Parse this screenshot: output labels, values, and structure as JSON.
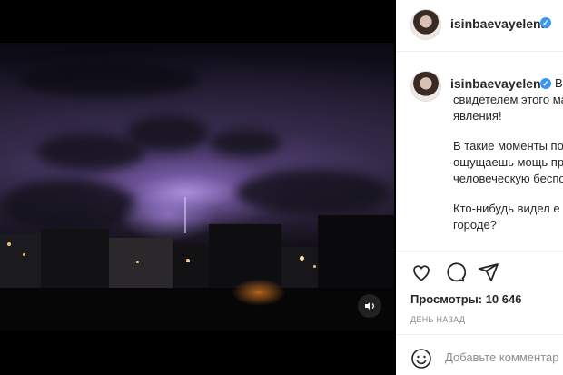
{
  "post": {
    "username": "isinbaevayelena",
    "caption_lines": [
      "В",
      "свидетелем этого ма",
      "явления!",
      "",
      "В такие моменты по",
      "ощущаешь мощь пр",
      "человеческую беспо",
      "",
      "Кто-нибудь видел е",
      "городе?"
    ],
    "views": "Просмотры: 10 646",
    "time_ago": "ДЕНЬ НАЗАД",
    "comment_placeholder": "Добавьте комментар"
  },
  "icons": {
    "like": "heart-icon",
    "comment": "comment-icon",
    "share": "send-icon",
    "emoji": "smile-icon",
    "mute": "speaker-icon",
    "verified": "verified-badge-icon"
  },
  "colors": {
    "verified": "#3897f0",
    "text": "#262626",
    "muted": "#8e8e8e"
  }
}
